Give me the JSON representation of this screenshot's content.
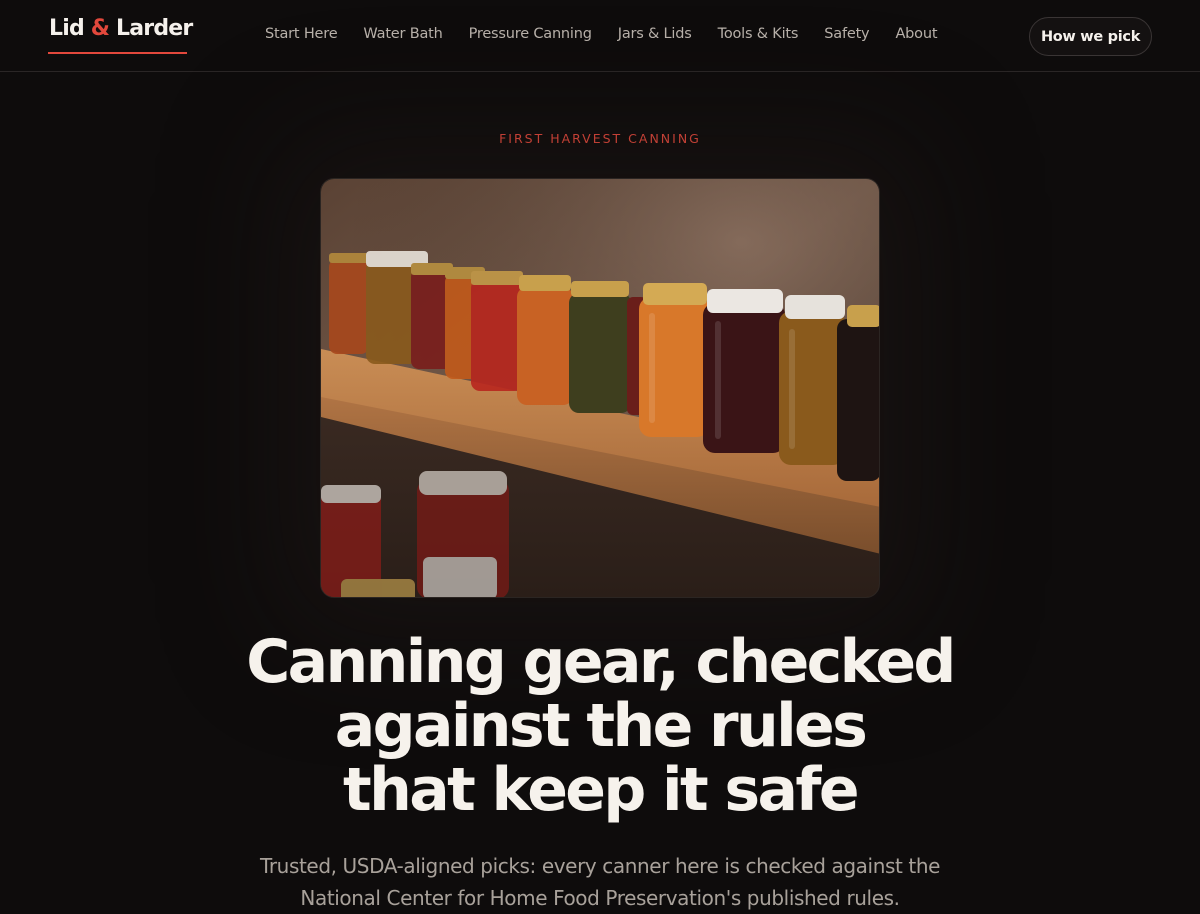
{
  "brand": {
    "name_part1": "Lid ",
    "ampersand": "&",
    "name_part2": " Larder",
    "accent_color": "#e2483c"
  },
  "nav": {
    "items": [
      {
        "label": "Start Here"
      },
      {
        "label": "Water Bath"
      },
      {
        "label": "Pressure Canning"
      },
      {
        "label": "Jars & Lids"
      },
      {
        "label": "Tools & Kits"
      },
      {
        "label": "Safety"
      },
      {
        "label": "About"
      }
    ],
    "cta_label": "How we pick"
  },
  "hero": {
    "eyebrow": "FIRST HARVEST CANNING",
    "image_icon": "canning-jars-on-shelf-photo",
    "headline_lines": [
      "Canning gear, checked",
      "against the rules",
      "that keep it safe"
    ],
    "subhead": "Trusted, USDA-aligned picks: every canner here is checked against the National Center for Home Food Preservation's published rules."
  },
  "colors": {
    "background": "#0e0c0c",
    "text": "#f6f2ec",
    "muted": "#a8a19a"
  }
}
